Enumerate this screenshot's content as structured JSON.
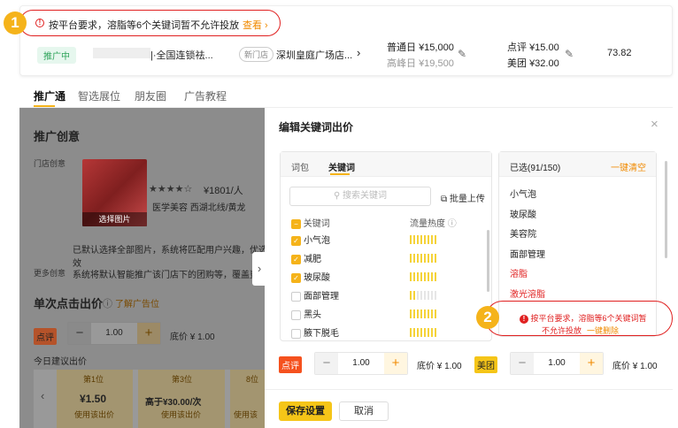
{
  "top_card": {
    "alert_text": "按平台要求，溶脂等6个关键词暂不允许投放",
    "alert_link": "查看",
    "badge1": "1",
    "status_tag": "推广中",
    "shop_name": "|·全国连锁祛...",
    "new_store_tag": "新门店",
    "location": "深圳皇庭广场店...",
    "normal_day_label": "普通日",
    "normal_day_price": "¥15,000",
    "peak_day_label": "高峰日",
    "peak_day_price": "¥19,500",
    "dianping_label": "点评",
    "dianping_price": "¥15.00",
    "meituan_label": "美团",
    "meituan_price": "¥32.00",
    "score": "73.82"
  },
  "tabs": [
    "推广通",
    "智选展位",
    "朋友圈",
    "广告教程"
  ],
  "left": {
    "section_title": "推广创意",
    "store_creative_label": "门店创意",
    "price": "¥1801/人",
    "category": "医学美容  西湖北线/黄龙",
    "select_image": "选择图片",
    "note": "已默认选择全部图片，系统将匹配用户兴趣，优选效",
    "more_creative_label": "更多创意",
    "more_creative_text": "系统将默认智能推广该门店下的团购等，覆盖更",
    "bid_title": "单次点击出价",
    "learn_ads": "了解广告位",
    "dianping": "点评",
    "bid_value": "1.00",
    "floor": "底价 ¥ 1.00",
    "today_suggest": "今日建议出价",
    "positions": [
      {
        "rank": "第1位",
        "price": "¥1.50",
        "action": "使用该出价"
      },
      {
        "rank": "第3位",
        "price": "高于¥30.00/次",
        "action": "使用该出价"
      },
      {
        "rank": "8位",
        "price": "",
        "action": "使用该"
      }
    ]
  },
  "modal": {
    "title": "编辑关键词出价",
    "tab_words": "词包",
    "tab_keywords": "关键词",
    "search_placeholder": "搜索关键词",
    "bulk_upload": "批量上传",
    "col_keyword": "关键词",
    "col_heat": "流量热度",
    "keywords": [
      {
        "name": "小气泡",
        "checked": true,
        "heat": "high"
      },
      {
        "name": "减肥",
        "checked": true,
        "heat": "high"
      },
      {
        "name": "玻尿酸",
        "checked": true,
        "heat": "high"
      },
      {
        "name": "面部管理",
        "checked": false,
        "heat": "low"
      },
      {
        "name": "黑头",
        "checked": false,
        "heat": "high"
      },
      {
        "name": "腋下脱毛",
        "checked": false,
        "heat": "high"
      }
    ],
    "selected_label": "已选(91/150)",
    "clear_all": "一键清空",
    "selected": [
      {
        "name": "小气泡",
        "blocked": false
      },
      {
        "name": "玻尿酸",
        "blocked": false
      },
      {
        "name": "美容院",
        "blocked": false
      },
      {
        "name": "面部管理",
        "blocked": false
      },
      {
        "name": "溶脂",
        "blocked": true
      },
      {
        "name": "激光溶脂",
        "blocked": true
      }
    ],
    "warning_line1": "按平台要求，溶脂等6个关键词暂",
    "warning_line2": "不允许投放",
    "delete_all": "一键删除",
    "badge2": "2",
    "dianping": "点评",
    "meituan": "美团",
    "bid_value": "1.00",
    "floor": "底价 ¥ 1.00",
    "save": "保存设置",
    "cancel": "取消"
  }
}
